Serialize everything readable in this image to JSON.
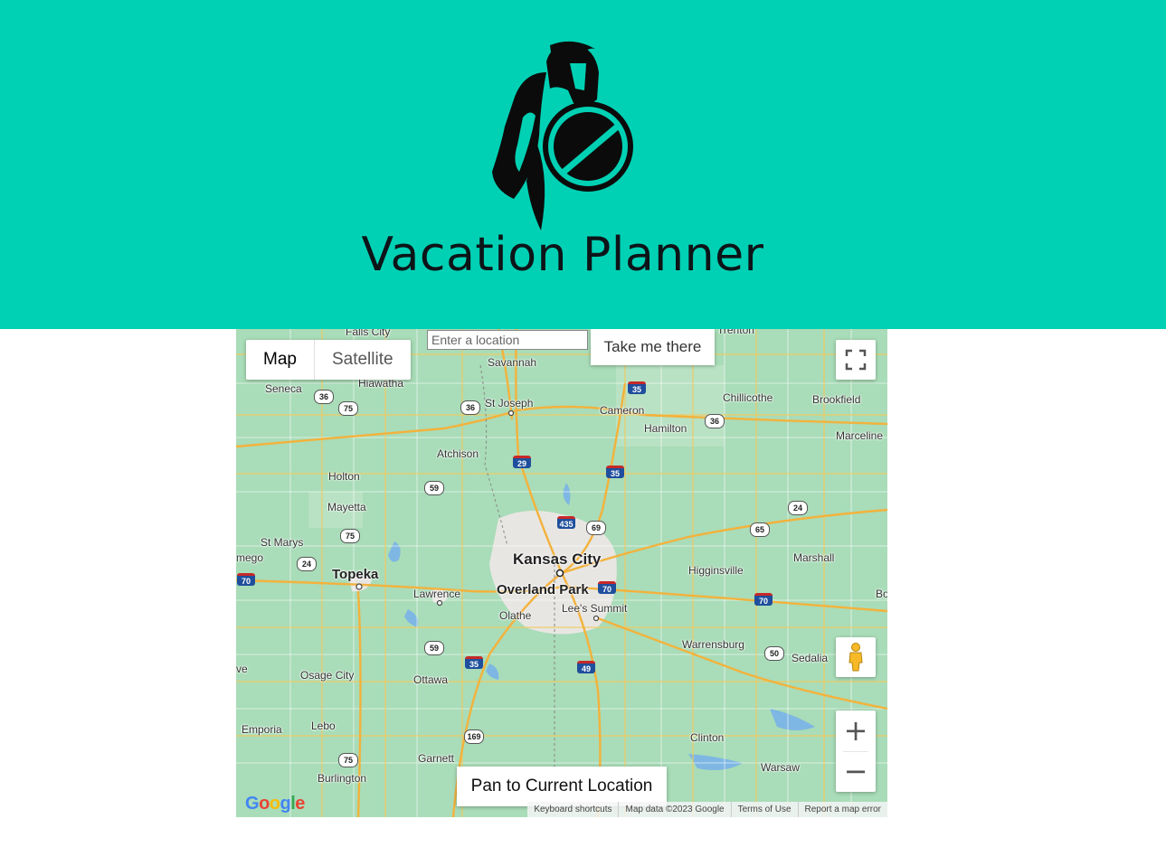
{
  "app": {
    "title": "Vacation Planner"
  },
  "map": {
    "type_buttons": {
      "map": "Map",
      "satellite": "Satellite"
    },
    "search": {
      "placeholder": "Enter a location",
      "button": "Take me there"
    },
    "pan_button": "Pan to Current Location",
    "zoom": {
      "in": "+",
      "out": "−"
    },
    "attribution": {
      "keyboard": "Keyboard shortcuts",
      "data": "Map data ©2023 Google",
      "terms": "Terms of Use",
      "report": "Report a map error"
    },
    "places": {
      "falls_city": "Falls City",
      "savannah": "Savannah",
      "trenton": "Trenton",
      "seneca": "Seneca",
      "hiawatha": "Hiawatha",
      "st_joseph": "St Joseph",
      "cameron": "Cameron",
      "chillicothe": "Chillicothe",
      "brookfield": "Brookfield",
      "hamilton": "Hamilton",
      "marceline": "Marceline",
      "atchison": "Atchison",
      "holton": "Holton",
      "mayetta": "Mayetta",
      "st_marys": "St Marys",
      "emego": "mego",
      "topeka": "Topeka",
      "kansas_city": "Kansas City",
      "higginsville": "Higginsville",
      "marshall": "Marshall",
      "bo": "Bo",
      "lawrence": "Lawrence",
      "overland_park": "Overland Park",
      "lees_summit": "Lee's Summit",
      "olathe": "Olathe",
      "warrensburg": "Warrensburg",
      "sedalia": "Sedalia",
      "ve": "ve",
      "osage_city": "Osage City",
      "ottawa": "Ottawa",
      "emporia": "Emporia",
      "lebo": "Lebo",
      "garnett": "Garnett",
      "clinton": "Clinton",
      "burlington": "Burlington",
      "warsaw": "Warsaw"
    },
    "shields": {
      "us36a": "36",
      "us75a": "75",
      "us36b": "36",
      "i35a": "35",
      "us36c": "36",
      "i29": "29",
      "i35b": "35",
      "us59a": "59",
      "i435": "435",
      "us69": "69",
      "us65": "65",
      "us24a": "24",
      "us75b": "75",
      "us24b": "24",
      "i70a": "70",
      "i70b": "70",
      "i70c": "70",
      "us59b": "59",
      "i35c": "35",
      "i49": "49",
      "us50": "50",
      "us169": "169",
      "us75c": "75"
    }
  }
}
